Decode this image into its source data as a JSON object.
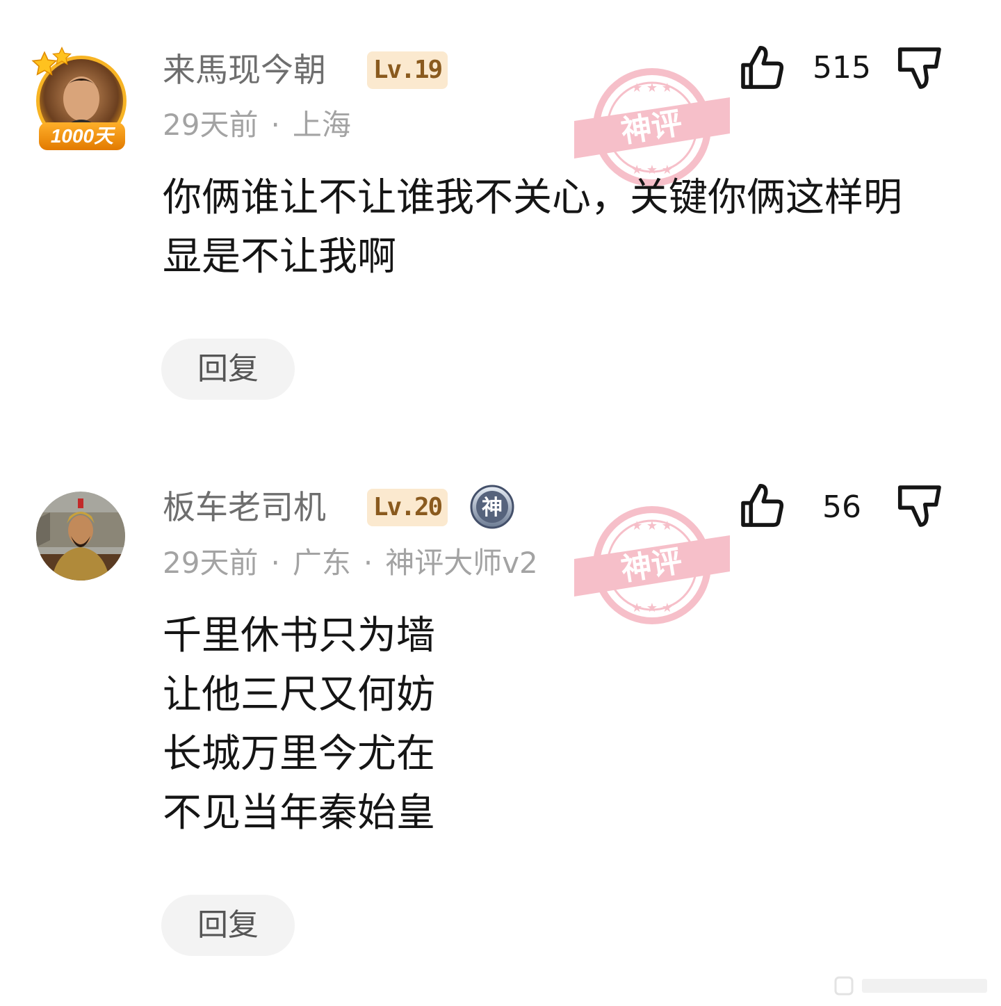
{
  "comments": [
    {
      "username": "来馬现今朝",
      "level": "Lv.19",
      "avatar_badge": "1000天",
      "time": "29天前",
      "location": "上海",
      "title": "",
      "like_count": "515",
      "body_lines": [
        "你俩谁让不让谁我不关心，关键你俩这样明",
        "显是不让我啊"
      ],
      "reply_label": "回复",
      "stamp_text": "神评"
    },
    {
      "username": "板车老司机",
      "level": "Lv.20",
      "special_badge": "神",
      "time": "29天前",
      "location": "广东",
      "title": "神评大师v2",
      "like_count": "56",
      "body_lines": [
        "千里休书只为墙",
        "让他三尺又何妨",
        "长城万里今尤在",
        "不见当年秦始皇"
      ],
      "reply_label": "回复",
      "stamp_text": "神评"
    }
  ],
  "icons": {
    "like": "thumbs-up-icon",
    "dislike": "thumbs-down-icon"
  },
  "colors": {
    "username": "#6e6e6e",
    "level_bg": "#fbe9cf",
    "level_text": "#8a5a1e",
    "meta": "#a3a3a3",
    "stamp": "#e85a72",
    "reply_bg": "#f3f3f3"
  }
}
